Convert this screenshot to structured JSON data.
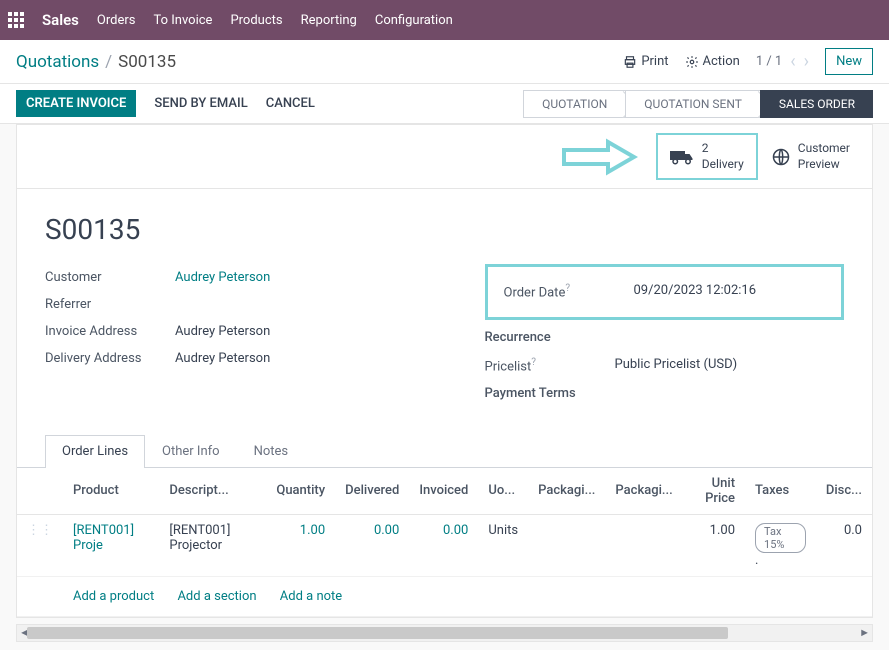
{
  "topbar": {
    "brand": "Sales",
    "nav": [
      "Orders",
      "To Invoice",
      "Products",
      "Reporting",
      "Configuration"
    ]
  },
  "breadcrumb": {
    "parent": "Quotations",
    "current": "S00135"
  },
  "toolbar": {
    "print": "Print",
    "action": "Action",
    "pager": "1 / 1",
    "new": "New"
  },
  "actions": {
    "create_invoice": "CREATE INVOICE",
    "send_email": "SEND BY EMAIL",
    "cancel": "CANCEL"
  },
  "steps": [
    "QUOTATION",
    "QUOTATION SENT",
    "SALES ORDER"
  ],
  "active_step": 2,
  "cards": {
    "delivery": {
      "count": "2",
      "label": "Delivery"
    },
    "preview": {
      "line1": "Customer",
      "line2": "Preview"
    }
  },
  "record": {
    "name": "S00135",
    "left_fields": [
      {
        "label": "Customer",
        "value": "Audrey Peterson",
        "link": true
      },
      {
        "label": "Referrer",
        "value": "",
        "link": false
      },
      {
        "label": "Invoice Address",
        "value": "Audrey Peterson",
        "link": false
      },
      {
        "label": "Delivery Address",
        "value": "Audrey Peterson",
        "link": false
      }
    ],
    "right_fields_highlight": {
      "label": "Order Date",
      "value": "09/20/2023 12:02:16",
      "help": true
    },
    "right_fields": [
      {
        "label": "Recurrence",
        "value": "",
        "help": false
      },
      {
        "label": "Pricelist",
        "value": "Public Pricelist (USD)",
        "help": true
      },
      {
        "label": "Payment Terms",
        "value": "",
        "help": false
      }
    ]
  },
  "tabs": [
    "Order Lines",
    "Other Info",
    "Notes"
  ],
  "active_tab": 0,
  "table": {
    "headers": [
      "Product",
      "Descript...",
      "Quantity",
      "Delivered",
      "Invoiced",
      "Uo...",
      "Packagi...",
      "Packagi...",
      "Unit Price",
      "Taxes",
      "Disc..."
    ],
    "rows": [
      {
        "product": "[RENT001] Proje",
        "description": "[RENT001] Projector",
        "quantity": "1.00",
        "delivered": "0.00",
        "invoiced": "0.00",
        "uom": "Units",
        "pack1": "",
        "pack2": "",
        "unit_price": "1.00",
        "tax": "Tax 15%",
        "disc": "0.0"
      }
    ],
    "add": {
      "product": "Add a product",
      "section": "Add a section",
      "note": "Add a note"
    }
  }
}
